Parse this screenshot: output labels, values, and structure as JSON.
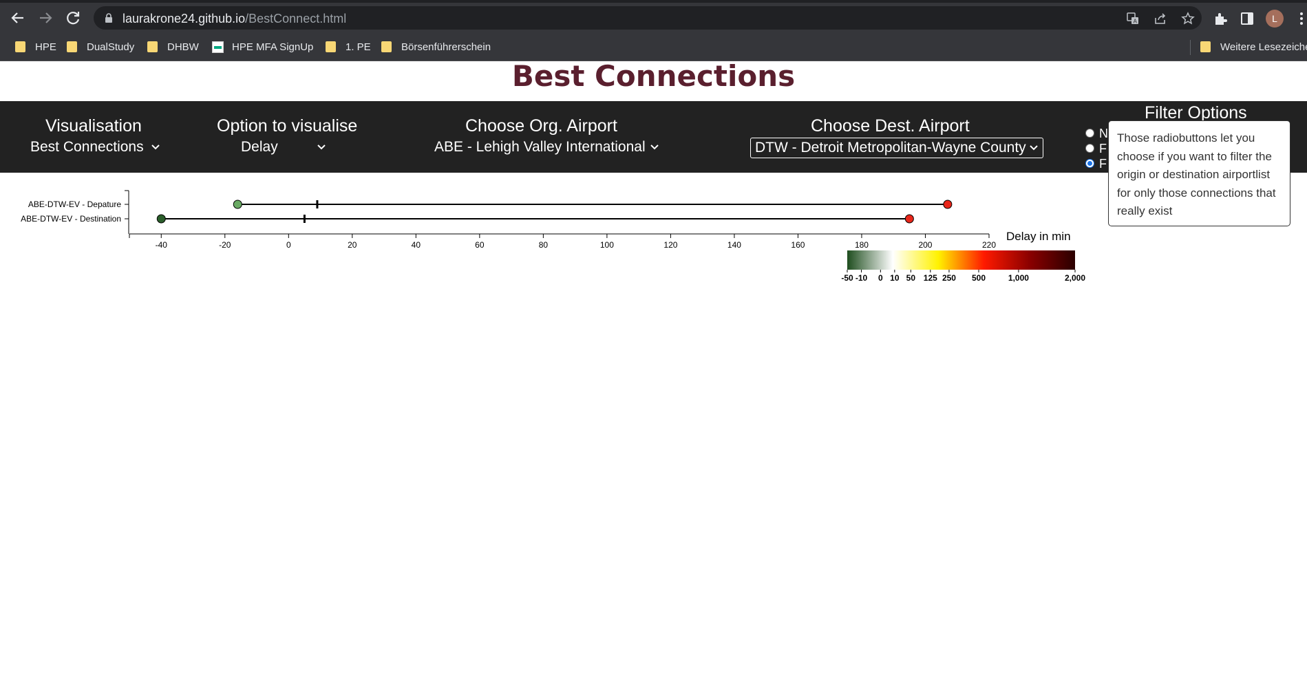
{
  "browser": {
    "url_host": "laurakrone24.github.io",
    "url_path": "/BestConnect.html",
    "avatar_letter": "L",
    "bookmarks": [
      {
        "label": "HPE",
        "icon": "folder-icon"
      },
      {
        "label": "DualStudy",
        "icon": "folder-icon"
      },
      {
        "label": "DHBW",
        "icon": "folder-icon"
      },
      {
        "label": "HPE MFA SignUp",
        "icon": "hpe-favicon"
      },
      {
        "label": "1. PE",
        "icon": "folder-icon"
      },
      {
        "label": "Börsenführerschein",
        "icon": "folder-icon"
      }
    ],
    "other_bookmarks": "Weitere Lesezeiche"
  },
  "page": {
    "title": "Best Connections",
    "title_color": "#5a1f2e",
    "controls": {
      "visualisation": {
        "label": "Visualisation",
        "value": "Best Connections"
      },
      "option": {
        "label": "Option to visualise",
        "value": "Delay"
      },
      "origin": {
        "label": "Choose Org. Airport",
        "value": "ABE - Lehigh Valley International"
      },
      "destination": {
        "label": "Choose Dest. Airport",
        "value": "DTW - Detroit Metropolitan-Wayne County"
      }
    },
    "filter": {
      "label": "Filter Options",
      "options": [
        {
          "label": "N",
          "selected": false
        },
        {
          "label": "F",
          "selected": false
        },
        {
          "label": "F",
          "selected": true
        }
      ],
      "tooltip": "Those radiobuttons let you choose if you want to filter the origin or destination airportlist for only those connections that really exist"
    }
  },
  "chart_data": {
    "type": "range",
    "xlabel": "Delay in min",
    "xlim": [
      -50,
      220
    ],
    "x_ticks": [
      -40,
      -20,
      0,
      20,
      40,
      60,
      80,
      100,
      120,
      140,
      160,
      180,
      200,
      220
    ],
    "rows": [
      {
        "label": "ABE-DTW-EV - Depature",
        "min": -16,
        "median": 9,
        "max": 207,
        "min_color": "#6aaa64",
        "max_color": "#e8261a"
      },
      {
        "label": "ABE-DTW-EV - Destination",
        "min": -40,
        "median": 5,
        "max": 195,
        "min_color": "#2b5e2b",
        "max_color": "#e8261a"
      }
    ],
    "color_scale": {
      "ticks": [
        "-50",
        "-10",
        "0",
        "10",
        "50",
        "125",
        "250",
        "500",
        "1,000",
        "2,000"
      ],
      "colors": [
        "#1e4d1e",
        "#ffffff",
        "#fff200",
        "#ff1a00",
        "#8b0000",
        "#2a0000"
      ]
    }
  }
}
